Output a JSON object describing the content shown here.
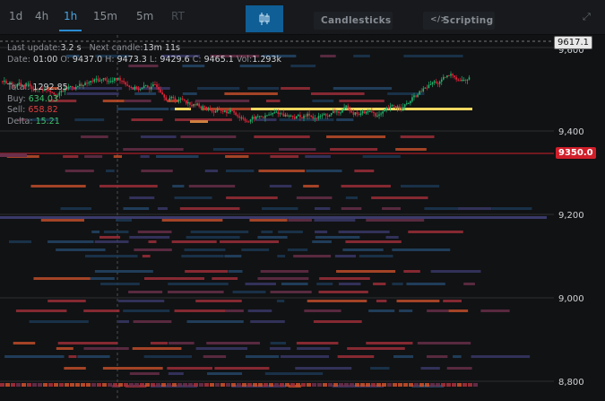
{
  "timeframes": [
    {
      "label": "1d",
      "state": "normal"
    },
    {
      "label": "4h",
      "state": "normal"
    },
    {
      "label": "1h",
      "state": "active"
    },
    {
      "label": "15m",
      "state": "normal"
    },
    {
      "label": "5m",
      "state": "normal"
    },
    {
      "label": "RT",
      "state": "disabled"
    }
  ],
  "toolbar": {
    "chart_type_icon": "candlestick-icon",
    "candlesticks_label": "Candlesticks",
    "scripting_label": "Scripting",
    "scripting_icon": "code-icon",
    "expand_icon": "expand-icon"
  },
  "status": {
    "last_update_label": "Last update:",
    "last_update_value": "3.2 s",
    "next_candle_label": "Next candle:",
    "next_candle_value": "13m 11s"
  },
  "ohlc": {
    "date_label": "Date:",
    "date": "01:00",
    "o_label": "O:",
    "o": "9437.0",
    "h_label": "H:",
    "h": "9473.3",
    "l_label": "L:",
    "l": "9429.6",
    "c_label": "C:",
    "c": "9465.1",
    "vol_label": "Vol:",
    "vol": "1.293k"
  },
  "volume": {
    "total_label": "Total:",
    "total": "1292.85",
    "buy_label": "Buy:",
    "buy": "634.03",
    "sell_label": "Sell:",
    "sell": "658.82",
    "delta_label": "Delta:",
    "delta": "15.21"
  },
  "price_axis": {
    "labels": [
      "9,600",
      "9,400",
      "9,200",
      "9,000",
      "8,800"
    ]
  },
  "tags": {
    "high": "9617.1",
    "current": "9350.0"
  },
  "colors": {
    "up": "#1fb36b",
    "down": "#e8233a",
    "current_line": "#d11f2a",
    "accent": "#2a8bd3",
    "bid_wall": "#f0d860"
  }
}
